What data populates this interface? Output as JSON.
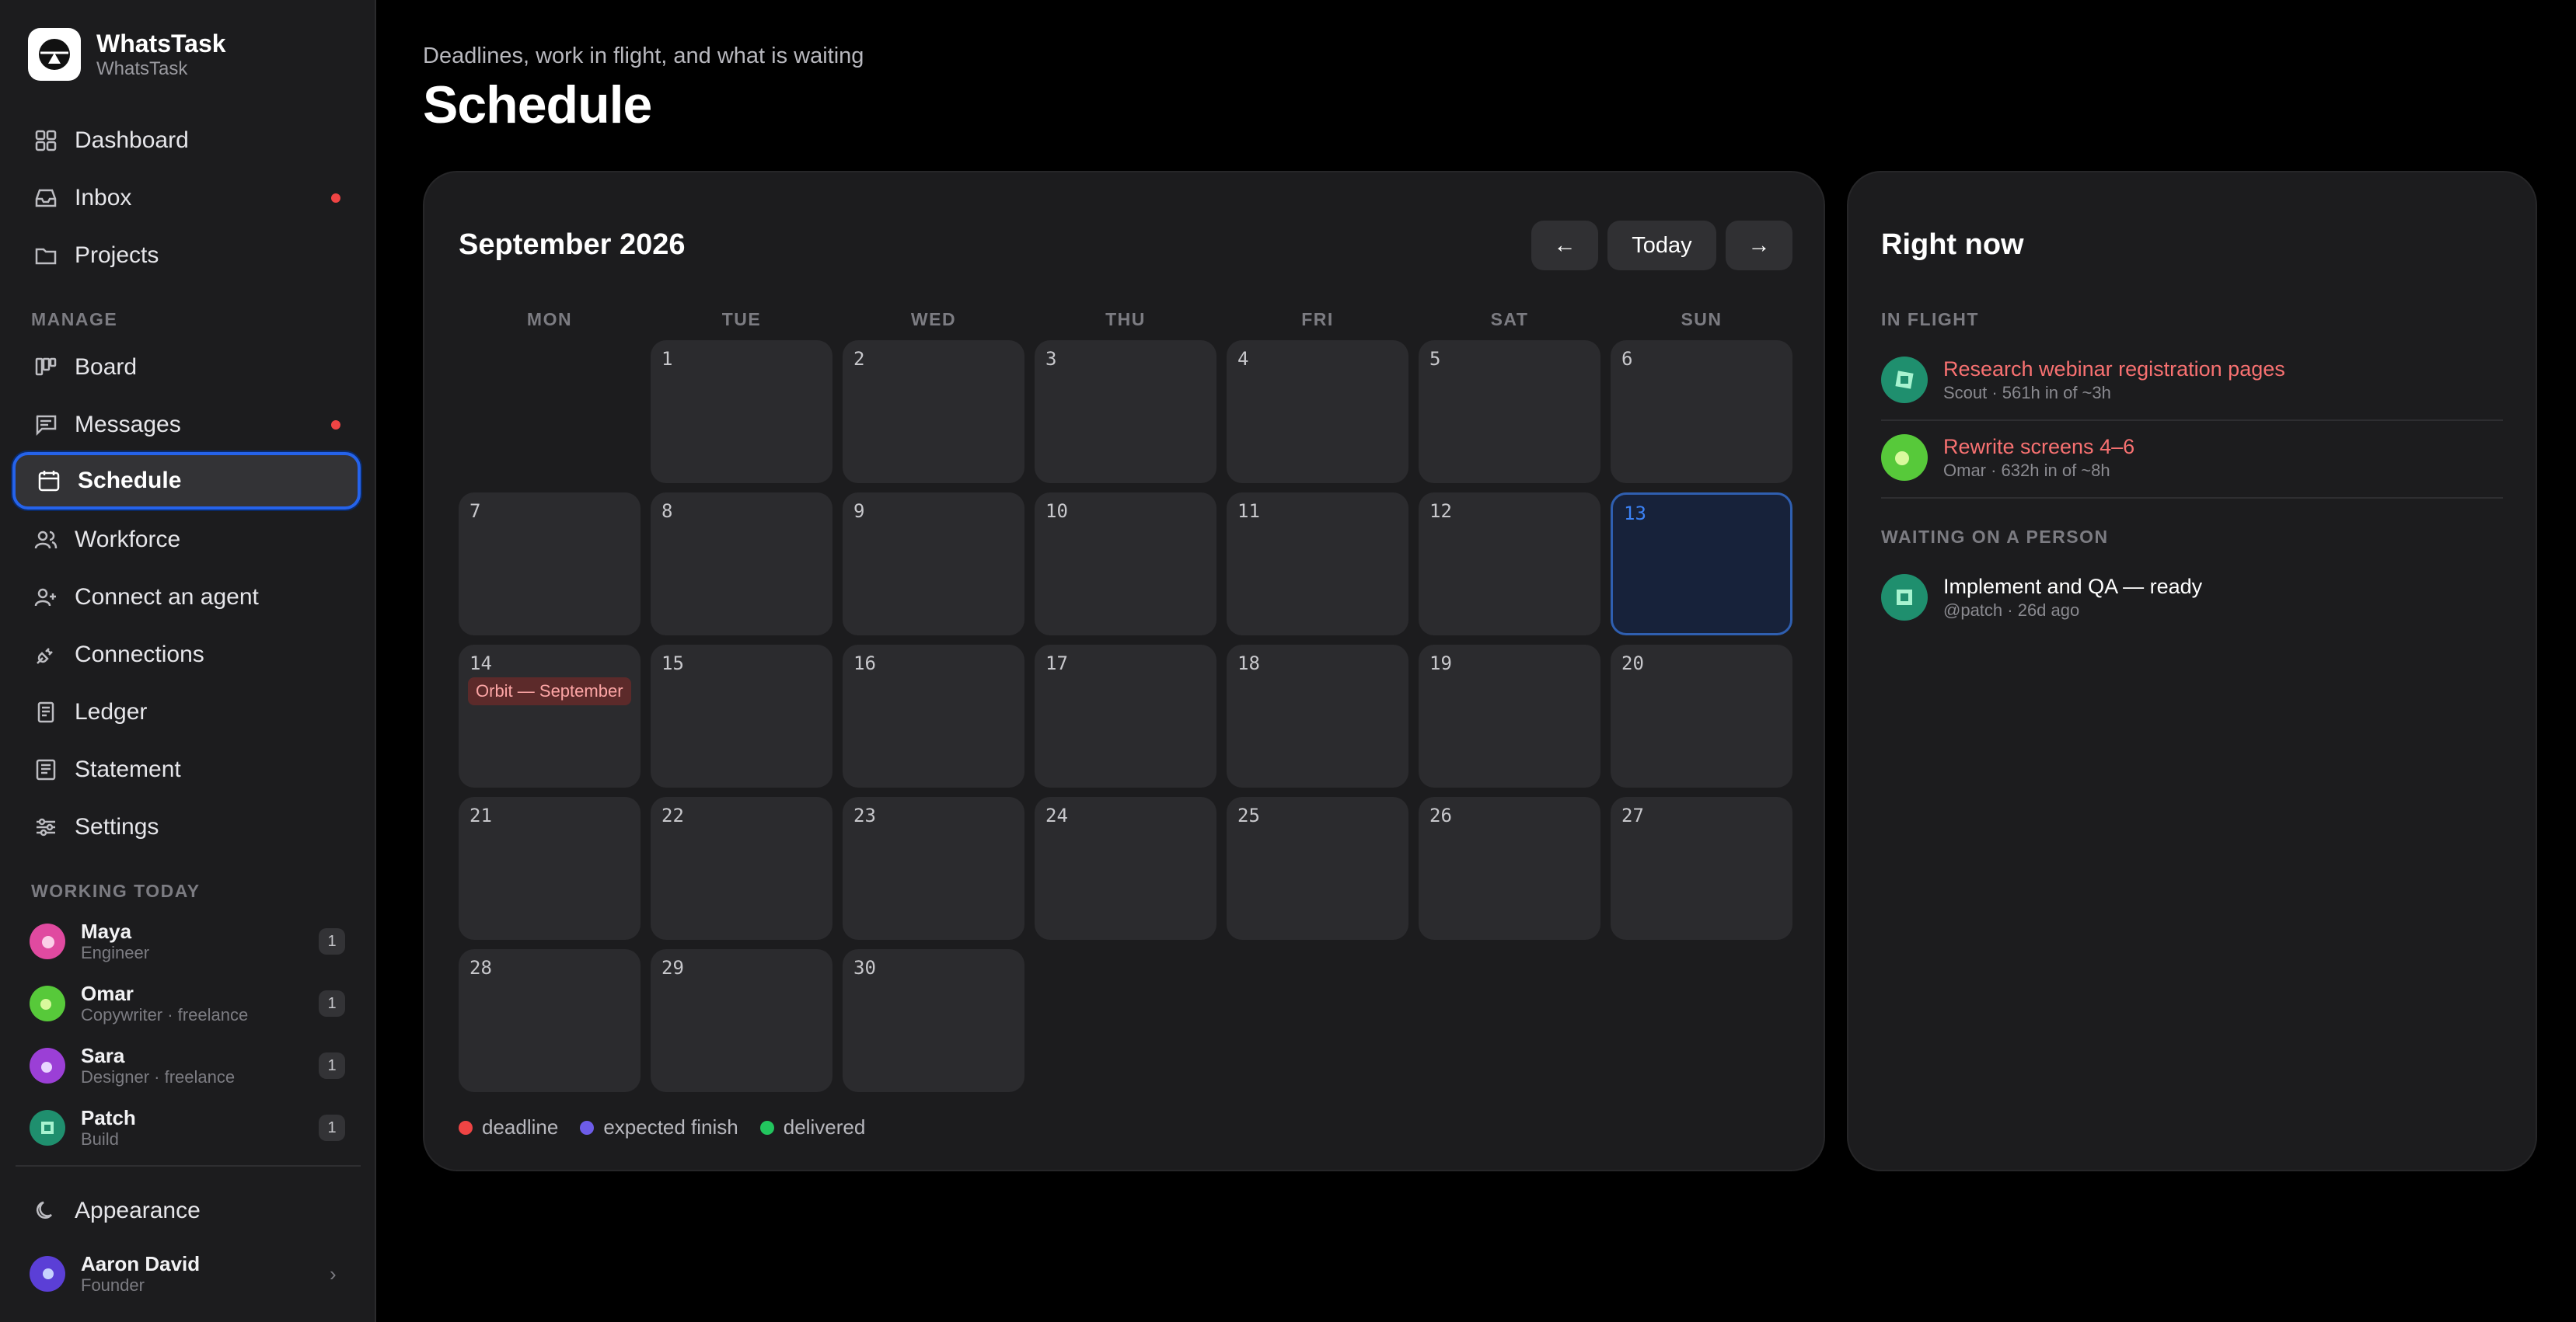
{
  "app": {
    "name": "WhatsTask",
    "subname": "WhatsTask"
  },
  "nav": {
    "dashboard": "Dashboard",
    "inbox": "Inbox",
    "projects": "Projects",
    "manage_label": "MANAGE",
    "board": "Board",
    "messages": "Messages",
    "schedule": "Schedule",
    "workforce": "Workforce",
    "connect_agent": "Connect an agent",
    "connections": "Connections",
    "ledger": "Ledger",
    "statement": "Statement",
    "settings": "Settings",
    "appearance": "Appearance"
  },
  "working_today": {
    "label": "WORKING TODAY",
    "people": [
      {
        "name": "Maya",
        "role": "Engineer",
        "count": "1"
      },
      {
        "name": "Omar",
        "role": "Copywriter · freelance",
        "count": "1"
      },
      {
        "name": "Sara",
        "role": "Designer · freelance",
        "count": "1"
      },
      {
        "name": "Patch",
        "role": "Build",
        "count": "1"
      }
    ]
  },
  "user": {
    "name": "Aaron David",
    "role": "Founder"
  },
  "header": {
    "subtitle": "Deadlines, work in flight, and what is waiting",
    "title": "Schedule"
  },
  "calendar": {
    "month": "September 2026",
    "today_label": "Today",
    "prev_label": "←",
    "next_label": "→",
    "weekdays": [
      "MON",
      "TUE",
      "WED",
      "THU",
      "FRI",
      "SAT",
      "SUN"
    ],
    "days": [
      "1",
      "2",
      "3",
      "4",
      "5",
      "6",
      "7",
      "8",
      "9",
      "10",
      "11",
      "12",
      "13",
      "14",
      "15",
      "16",
      "17",
      "18",
      "19",
      "20",
      "21",
      "22",
      "23",
      "24",
      "25",
      "26",
      "27",
      "28",
      "29",
      "30"
    ],
    "event_14": "Orbit — September",
    "legend": {
      "deadline": "deadline",
      "expected": "expected finish",
      "delivered": "delivered"
    }
  },
  "right_now": {
    "title": "Right now",
    "in_flight_label": "IN FLIGHT",
    "waiting_label": "WAITING ON A PERSON",
    "in_flight": [
      {
        "title": "Research webinar registration pages",
        "meta": "Scout · 561h in of ~3h"
      },
      {
        "title": "Rewrite screens 4–6",
        "meta": "Omar · 632h in of ~8h"
      }
    ],
    "waiting": [
      {
        "title": "Implement and QA — ready",
        "meta": "@patch · 26d ago"
      }
    ]
  },
  "colors": {
    "accent": "#2563eb",
    "deadline": "#ef4444",
    "expected": "#6d5ce8",
    "delivered": "#22c55e"
  }
}
